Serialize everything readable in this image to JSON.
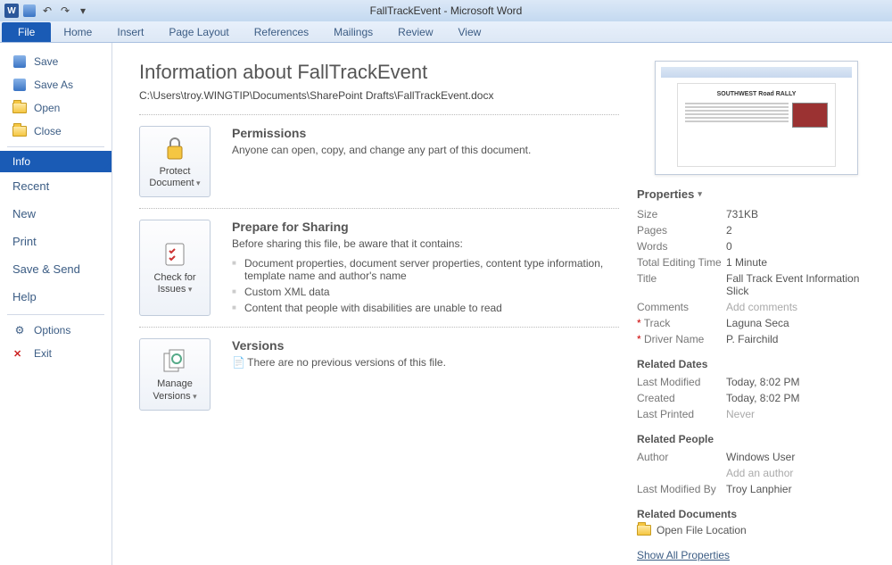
{
  "window_title": "FallTrackEvent - Microsoft Word",
  "ribbon_tabs": {
    "file": "File",
    "home": "Home",
    "insert": "Insert",
    "page_layout": "Page Layout",
    "references": "References",
    "mailings": "Mailings",
    "review": "Review",
    "view": "View"
  },
  "sidebar": {
    "save": "Save",
    "save_as": "Save As",
    "open": "Open",
    "close": "Close",
    "info": "Info",
    "recent": "Recent",
    "new": "New",
    "print": "Print",
    "save_send": "Save & Send",
    "help": "Help",
    "options": "Options",
    "exit": "Exit"
  },
  "info": {
    "heading": "Information about FallTrackEvent",
    "path": "C:\\Users\\troy.WINGTIP\\Documents\\SharePoint Drafts\\FallTrackEvent.docx",
    "permissions": {
      "btn": "Protect Document",
      "title": "Permissions",
      "text": "Anyone can open, copy, and change any part of this document."
    },
    "sharing": {
      "btn": "Check for Issues",
      "title": "Prepare for Sharing",
      "text": "Before sharing this file, be aware that it contains:",
      "bullets": [
        "Document properties, document server properties, content type information, template name and author's name",
        "Custom XML data",
        "Content that people with disabilities are unable to read"
      ]
    },
    "versions": {
      "btn": "Manage Versions",
      "title": "Versions",
      "text": "There are no previous versions of this file."
    }
  },
  "thumb": {
    "title": "SOUTHWEST Road RALLY"
  },
  "properties": {
    "header": "Properties",
    "size_l": "Size",
    "size_v": "731KB",
    "pages_l": "Pages",
    "pages_v": "2",
    "words_l": "Words",
    "words_v": "0",
    "edit_l": "Total Editing Time",
    "edit_v": "1 Minute",
    "title_l": "Title",
    "title_v": "Fall Track Event Information Slick",
    "comments_l": "Comments",
    "comments_v": "Add comments",
    "track_l": "Track",
    "track_v": "Laguna Seca",
    "driver_l": "Driver Name",
    "driver_v": "P. Fairchild",
    "dates_header": "Related Dates",
    "modified_l": "Last Modified",
    "modified_v": "Today, 8:02 PM",
    "created_l": "Created",
    "created_v": "Today, 8:02 PM",
    "printed_l": "Last Printed",
    "printed_v": "Never",
    "people_header": "Related People",
    "author_l": "Author",
    "author_v": "Windows User",
    "add_author": "Add an author",
    "lastmodby_l": "Last Modified By",
    "lastmodby_v": "Troy Lanphier",
    "docs_header": "Related Documents",
    "open_loc": "Open File Location",
    "show_all": "Show All Properties"
  }
}
